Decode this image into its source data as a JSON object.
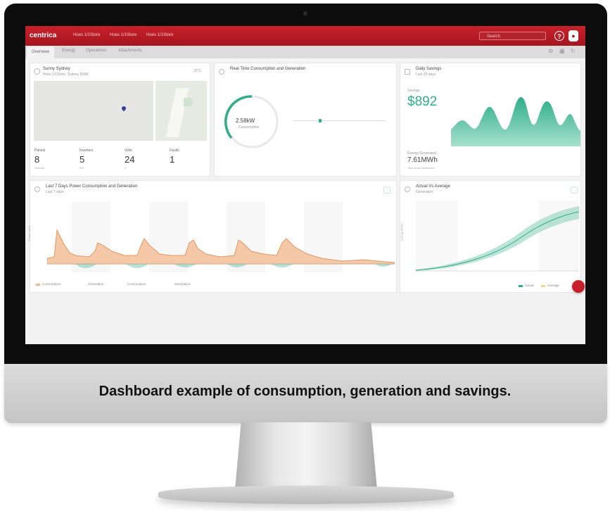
{
  "topbar": {
    "logo": "centrica",
    "breadcrumb": [
      "Hoes 1/1Store",
      "Hoes 1/1Store",
      "Hoes 1/1Store"
    ],
    "search_placeholder": "Search"
  },
  "tabs": [
    "Overview",
    "Energy",
    "Operations",
    "Attachments"
  ],
  "site_details": {
    "title": "Sunny Sydney",
    "subtitle": "Hoes 1/1Store, Sydney NSW",
    "weather": "22°C",
    "stats": [
      {
        "label": "Panels",
        "value": "8",
        "sub": "Kilowatt"
      },
      {
        "label": "Inverters",
        "value": "5",
        "sub": "kW"
      },
      {
        "label": "Volts",
        "value": "24",
        "sub": "V"
      },
      {
        "label": "Faults",
        "value": "1",
        "sub": ""
      }
    ]
  },
  "realtime": {
    "title": "Real-Time Consumption and Generation",
    "gauge_value": "2.58kW",
    "gauge_sub": "Consumption"
  },
  "savings": {
    "title": "Daily Savings",
    "subtitle": "Last 30 days",
    "label": "Savings",
    "value": "$892",
    "energy_label": "Energy Generated",
    "energy_value": "7.61MWh",
    "energy_sub": "Total since installation"
  },
  "consumption_chart": {
    "title": "Last 7 Days Power Consumption and Generation",
    "subtitle": "Last 7 days",
    "ylabel": "Power (kW)",
    "legend": [
      "Consumption",
      "Generation",
      "Consumption",
      "Generation"
    ]
  },
  "forecast_chart": {
    "title": "Actual Vs Average",
    "subtitle": "Generation",
    "ylabel": "Energy (kWh)",
    "legend": [
      "Actual",
      "Average"
    ]
  },
  "caption": "Dashboard example of consumption, generation and savings.",
  "colors": {
    "brand_red": "#c8202a",
    "consumption": "#f2b58b",
    "generation": "#2fae8a"
  }
}
